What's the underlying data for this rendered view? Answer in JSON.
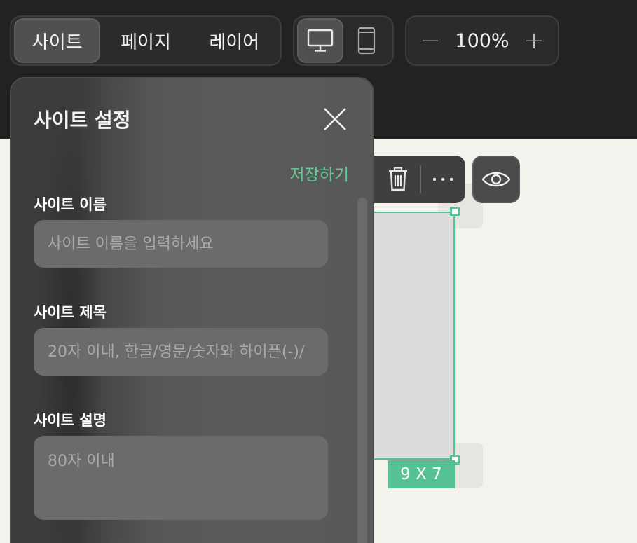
{
  "tabs": {
    "site": "사이트",
    "page": "페이지",
    "layer": "레이어"
  },
  "devices": {
    "desktop_icon": "desktop-icon",
    "mobile_icon": "mobile-icon"
  },
  "zoom": {
    "minus": "−",
    "value": "100%",
    "plus": "+"
  },
  "canvas": {
    "size_badge": "9 X 7",
    "accent_color": "#56c294"
  },
  "toolbar": {
    "delete_icon": "trash-icon",
    "more_icon": "more-icon",
    "preview_icon": "eye-icon"
  },
  "settings_panel": {
    "title": "사이트 설정",
    "save_label": "저장하기",
    "fields": {
      "name": {
        "label": "사이트 이름",
        "placeholder": "사이트 이름을 입력하세요"
      },
      "title": {
        "label": "사이트 제목",
        "placeholder": "20자 이내, 한글/영문/숫자와 하이픈(-)/"
      },
      "description": {
        "label": "사이트 설명",
        "placeholder": "80자 이내"
      }
    }
  }
}
